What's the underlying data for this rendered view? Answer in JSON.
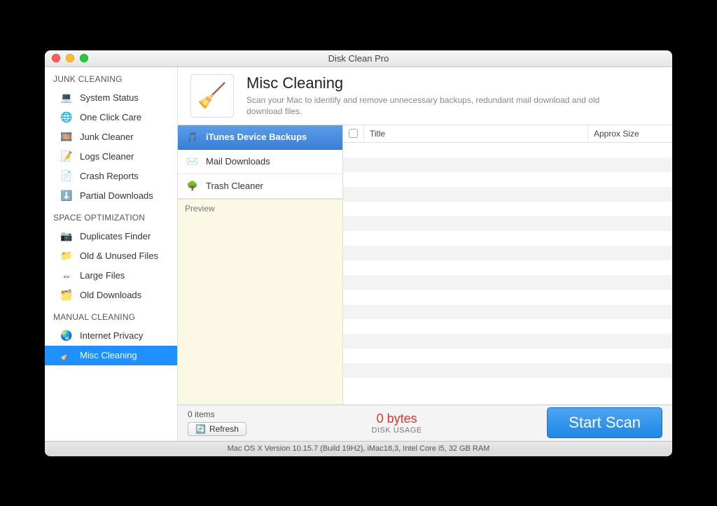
{
  "window": {
    "title": "Disk Clean Pro"
  },
  "sidebar": {
    "groups": [
      {
        "header": "JUNK CLEANING",
        "items": [
          {
            "label": "System Status",
            "icon": "💻"
          },
          {
            "label": "One Click Care",
            "icon": "🌐"
          },
          {
            "label": "Junk Cleaner",
            "icon": "🎞️"
          },
          {
            "label": "Logs Cleaner",
            "icon": "📝"
          },
          {
            "label": "Crash Reports",
            "icon": "📄"
          },
          {
            "label": "Partial Downloads",
            "icon": "⬇️"
          }
        ]
      },
      {
        "header": "SPACE OPTIMIZATION",
        "items": [
          {
            "label": "Duplicates Finder",
            "icon": "📷"
          },
          {
            "label": "Old & Unused Files",
            "icon": "📁"
          },
          {
            "label": "Large Files",
            "icon": "⇔"
          },
          {
            "label": "Old Downloads",
            "icon": "🗂️"
          }
        ]
      },
      {
        "header": "MANUAL CLEANING",
        "items": [
          {
            "label": "Internet Privacy",
            "icon": "🌏"
          },
          {
            "label": "Misc Cleaning",
            "icon": "🧹",
            "selected": true
          }
        ]
      }
    ]
  },
  "header": {
    "title": "Misc Cleaning",
    "subtitle": "Scan your Mac to identify and remove unnecessary backups, redundant mail download and old download files."
  },
  "categories": [
    {
      "label": "iTunes Device Backups",
      "icon": "🎵",
      "selected": true
    },
    {
      "label": "Mail Downloads",
      "icon": "✉️"
    },
    {
      "label": "Trash Cleaner",
      "icon": "🌳"
    }
  ],
  "preview": {
    "label": "Preview"
  },
  "table": {
    "columns": {
      "title": "Title",
      "size": "Approx Size"
    }
  },
  "footer": {
    "items": "0 items",
    "refresh": "Refresh",
    "bytes": "0 bytes",
    "usage": "DISK USAGE",
    "start": "Start Scan"
  },
  "status": "Mac OS X Version 10.15.7 (Build 19H2), iMac18,3, Intel Core i5, 32 GB RAM"
}
